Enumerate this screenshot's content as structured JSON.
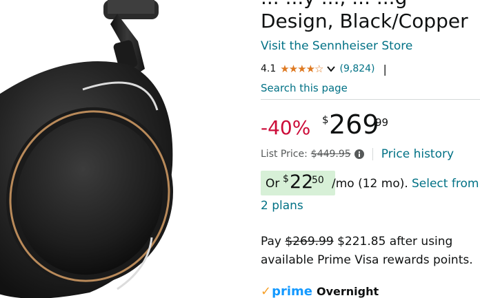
{
  "product": {
    "title_line1_partial": "... ...y ..., ... ...g",
    "title_line2": "Design, Black/Copper",
    "store_link": "Visit the Sennheiser Store",
    "rating_value": "4.1",
    "rating_stars": "★★★★☆",
    "rating_count": "(9,824)",
    "rating_pipe": "|",
    "search_link": "Search this page"
  },
  "price": {
    "discount": "-40%",
    "currency_symbol": "$",
    "whole": "269",
    "fraction": "99",
    "list_price_label": "List Price:",
    "list_price": "$449.95",
    "history_link": "Price history"
  },
  "monthly": {
    "or": "Or",
    "currency_symbol": "$",
    "whole": "22",
    "fraction": "50",
    "rest": "/mo (12 mo).",
    "select_link": "Select from",
    "plans_link": "2 plans"
  },
  "pay": {
    "prefix": "Pay",
    "old_price": "$269.99",
    "new_price_text": "$221.85 after using available Prime Visa rewards points."
  },
  "prime": {
    "check": "✓",
    "logo_text": "prime",
    "delivery": "Overnight"
  },
  "icons": {
    "chevron": "chevron-down-icon",
    "info": "info-icon",
    "product_image": "headphones-ear-cup-image"
  },
  "colors": {
    "link": "#007185",
    "discount": "#cc0c39",
    "star": "#de7921",
    "monthly_bg": "#d7f0d7",
    "prime_blue": "#1399ff",
    "prime_check": "#f7a12a"
  }
}
